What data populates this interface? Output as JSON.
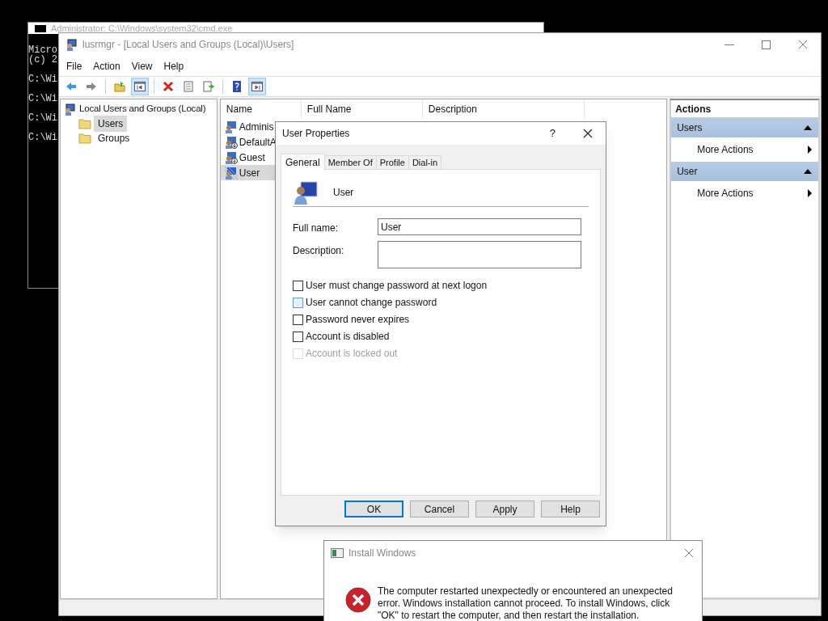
{
  "console": {
    "title": "Administrator: C:\\Windows\\system32\\cmd.exe",
    "lines": [
      "Micro",
      "(c) 2",
      "C:\\Wi",
      "C:\\Wi",
      "C:\\Wi",
      "C:\\Wi"
    ]
  },
  "window": {
    "title": "lusrmgr - [Local Users and Groups (Local)\\Users]"
  },
  "menu": [
    "File",
    "Action",
    "View",
    "Help"
  ],
  "toolbar": [
    {
      "kind": "back"
    },
    {
      "kind": "forward"
    },
    {
      "kind": "sep"
    },
    {
      "kind": "up"
    },
    {
      "kind": "tree",
      "on": true
    },
    {
      "kind": "sep"
    },
    {
      "kind": "delete"
    },
    {
      "kind": "properties"
    },
    {
      "kind": "export"
    },
    {
      "kind": "sep"
    },
    {
      "kind": "help"
    },
    {
      "kind": "actionpane",
      "on": true
    }
  ],
  "tree": {
    "label": "Local Users and Groups (Local)",
    "children": [
      {
        "label": "Users",
        "selected": true
      },
      {
        "label": "Groups",
        "selected": false
      }
    ]
  },
  "list": {
    "columns": [
      "Name",
      "Full Name",
      "Description"
    ],
    "rows": [
      {
        "name": "Adminis",
        "kind": "admin",
        "selected": false
      },
      {
        "name": "DefaultA",
        "kind": "disabled-user",
        "selected": false
      },
      {
        "name": "Guest",
        "kind": "disabled-user",
        "selected": false
      },
      {
        "name": "User",
        "kind": "active-user",
        "selected": true
      }
    ]
  },
  "actions": {
    "title": "Actions",
    "sections": [
      {
        "label": "Users",
        "expanded": true,
        "items": [
          "More Actions"
        ]
      },
      {
        "label": "User",
        "expanded": true,
        "items": [
          "More Actions"
        ]
      }
    ]
  },
  "dialog": {
    "title": "User Properties",
    "help": "?",
    "tabs": [
      {
        "label": "General",
        "selected": true
      },
      {
        "label": "Member Of",
        "selected": false
      },
      {
        "label": "Profile",
        "selected": false
      },
      {
        "label": "Dial-in",
        "selected": false
      }
    ],
    "user": "User",
    "fields": [
      {
        "label": "Full name:",
        "value": "User",
        "kind": "line"
      },
      {
        "label": "Description:",
        "kind": "box"
      }
    ],
    "options": [
      {
        "label": "User must change password at next logon",
        "checked": false,
        "disabled": false,
        "hovered": false
      },
      {
        "label": "User cannot change password",
        "checked": false,
        "disabled": false,
        "hovered": true
      },
      {
        "label": "Password never expires",
        "checked": false,
        "disabled": false,
        "hovered": false
      },
      {
        "label": "Account is disabled",
        "checked": false,
        "disabled": false,
        "hovered": false
      },
      {
        "label": "Account is locked out",
        "checked": false,
        "disabled": true,
        "hovered": false
      }
    ],
    "buttons": [
      {
        "label": "OK",
        "default": true
      },
      {
        "label": "Cancel",
        "default": false
      },
      {
        "label": "Apply",
        "default": false
      },
      {
        "label": "Help",
        "default": false
      }
    ]
  },
  "error": {
    "title": "Install Windows",
    "message": "The computer restarted unexpectedly or encountered an unexpected error. Windows installation cannot proceed. To install Windows, click \"OK\" to restart the computer, and then restart the installation."
  }
}
